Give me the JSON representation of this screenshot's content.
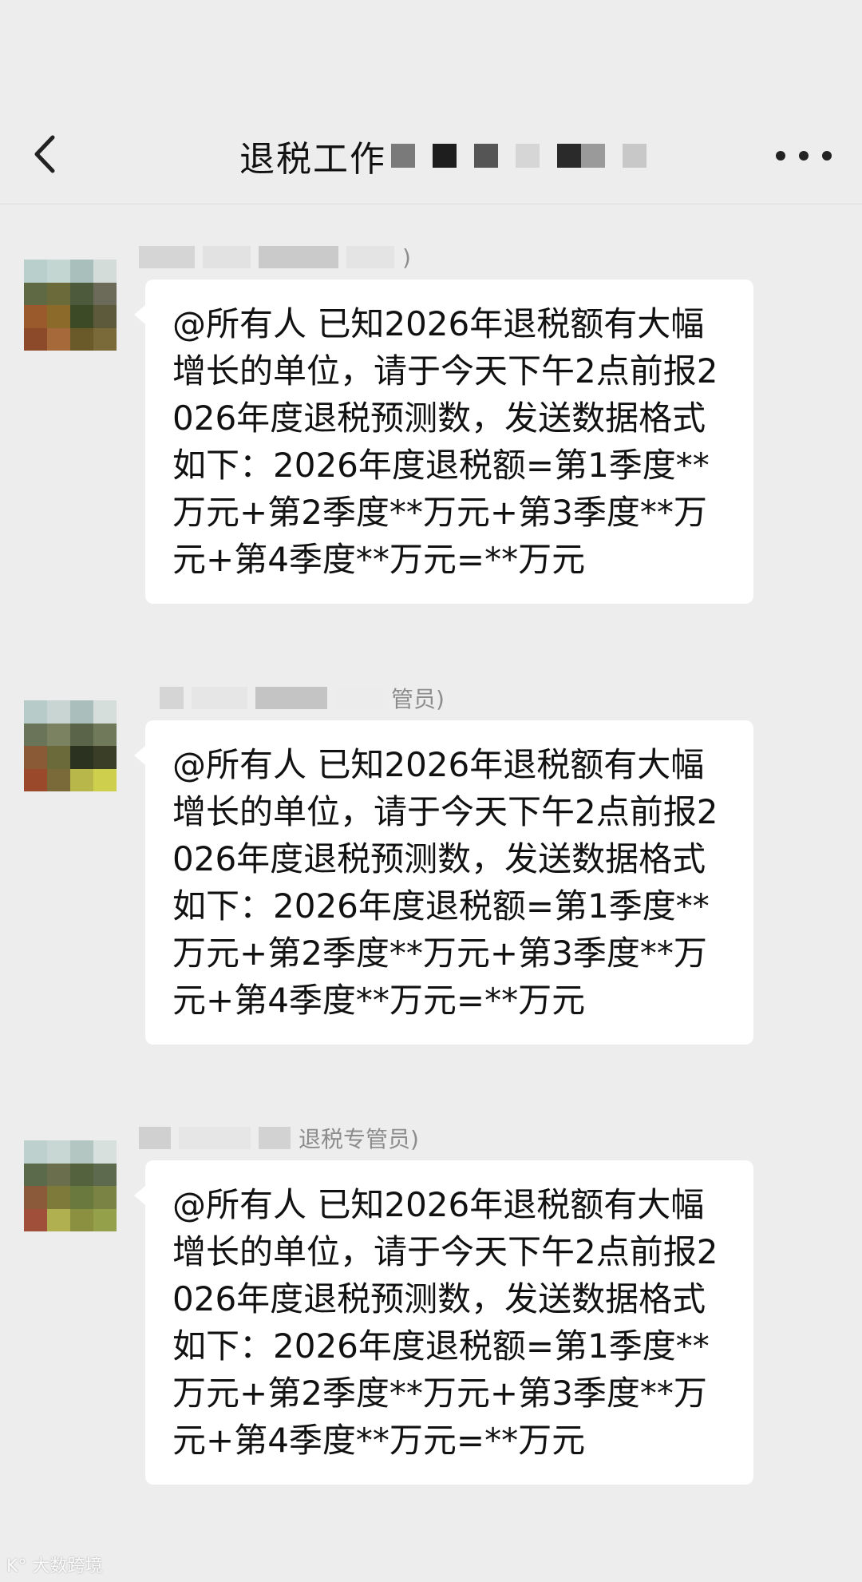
{
  "header": {
    "title": "退税工作",
    "back_icon": "chevron-left-icon",
    "more_icon": "more-horizontal-icon"
  },
  "messages": [
    {
      "sender_suffix": ")",
      "text": "@所有人 已知2026年退税额有大幅增长的单位，请于今天下午2点前报2026年度退税预测数，发送数据格式如下：2026年度退税额=第1季度**万元+第2季度**万元+第3季度**万元+第4季度**万元=**万元"
    },
    {
      "sender_suffix": "管员)",
      "text": "@所有人 已知2026年退税额有大幅增长的单位，请于今天下午2点前报2026年度退税预测数，发送数据格式如下：2026年度退税额=第1季度**万元+第2季度**万元+第3季度**万元+第4季度**万元=**万元"
    },
    {
      "sender_suffix": "退税专管员)",
      "text": "@所有人 已知2026年退税额有大幅增长的单位，请于今天下午2点前报2026年度退税预测数，发送数据格式如下：2026年度退税额=第1季度**万元+第2季度**万元+第3季度**万元+第4季度**万元=**万元"
    }
  ],
  "watermark": "大数跨境",
  "colors": {
    "background": "#ededed",
    "bubble": "#ffffff",
    "text": "#111111",
    "sender": "#8c8c8c"
  }
}
